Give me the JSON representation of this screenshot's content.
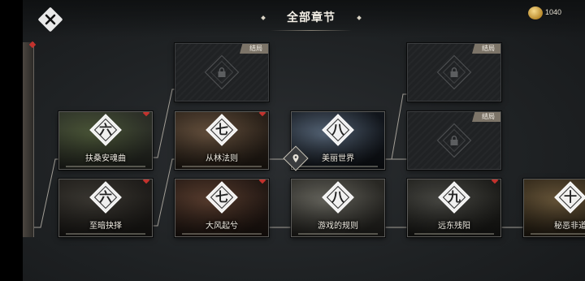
{
  "header": {
    "title": "全部章节",
    "coins": "1040"
  },
  "ending_tag": "结局",
  "chapters": [
    {
      "id": "c1",
      "numeral": "六",
      "name": "扶桑安魂曲",
      "colors": [
        "#4e5a3a",
        "#2c2f28"
      ]
    },
    {
      "id": "c2",
      "numeral": "六",
      "name": "至暗抉择",
      "colors": [
        "#3d3a34",
        "#1f1d1a"
      ]
    },
    {
      "id": "c3",
      "numeral": "七",
      "name": "从林法则",
      "colors": [
        "#6a5440",
        "#2a2119"
      ]
    },
    {
      "id": "c4",
      "numeral": "七",
      "name": "大风起兮",
      "colors": [
        "#5c3f30",
        "#241914"
      ]
    },
    {
      "id": "c5",
      "numeral": "八",
      "name": "美丽世界",
      "colors": [
        "#5a6a7d",
        "#12161c"
      ]
    },
    {
      "id": "c6",
      "numeral": "八",
      "name": "游戏的规则",
      "colors": [
        "#6b6a62",
        "#2a2925"
      ]
    },
    {
      "id": "c7",
      "numeral": "九",
      "name": "远东残阳",
      "colors": [
        "#4b4b46",
        "#1e1e1b"
      ]
    },
    {
      "id": "c8",
      "numeral": "十",
      "name": "秘恶非道",
      "colors": [
        "#6d5a3c",
        "#2a2216"
      ]
    }
  ],
  "icons": {
    "close": "close-icon",
    "coin": "coin-icon",
    "lock": "lock-icon",
    "location": "location-pin-icon"
  }
}
